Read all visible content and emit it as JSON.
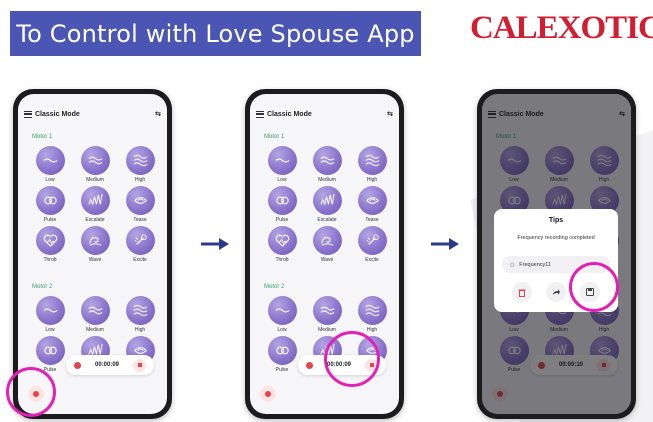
{
  "banner": {
    "title": "To Control with Love Spouse App"
  },
  "brand": {
    "name": "CALEXOTICS",
    "mark": "®"
  },
  "colors": {
    "banner": "#4b56b4",
    "brand": "#d21e33",
    "highlight": "#e41fb6",
    "motor_label": "#3aa06a",
    "record": "#e2454d"
  },
  "phones": [
    {
      "mode_title": "Classic Mode",
      "motor1_label": "Motor 1",
      "motor2_label": "Motor 2",
      "motor1_patterns": [
        "Low",
        "Medium",
        "High",
        "Pulse",
        "Escalate",
        "Tease",
        "Throb",
        "Wave",
        "Excite"
      ],
      "motor2_patterns": [
        "Low",
        "Medium",
        "High",
        "Pulse",
        "",
        "Tease"
      ],
      "timer": "00:00:09"
    },
    {
      "mode_title": "Classic Mode",
      "motor1_label": "Motor 1",
      "motor2_label": "Motor 2",
      "motor1_patterns": [
        "Low",
        "Medium",
        "High",
        "Pulse",
        "Escalate",
        "Tease",
        "Throb",
        "Wave",
        "Excite"
      ],
      "motor2_patterns": [
        "Low",
        "Medium",
        "High",
        "Pulse",
        "",
        "Tease"
      ],
      "timer": "00:00:09"
    },
    {
      "mode_title": "Classic Mode",
      "motor1_label": "Motor 1",
      "motor2_label": "Motor 2",
      "motor1_patterns": [
        "Low",
        "Medium",
        "High",
        "Pulse",
        "Escalate",
        "Tease",
        "Throb",
        "Wave",
        "Excite"
      ],
      "motor2_patterns": [
        "Low",
        "Medium",
        "High",
        "Pulse",
        "",
        "Tease"
      ],
      "timer": "00:00:10",
      "dialog": {
        "title": "Tips",
        "message": "Frequency recording completed",
        "item": "Frequency11"
      }
    }
  ],
  "icons": {
    "patterns": [
      "low-wave-icon",
      "medium-wave-icon",
      "high-wave-icon",
      "pulse-icon",
      "escalate-icon",
      "tease-icon",
      "throb-heart-icon",
      "wave-swirl-icon",
      "excite-icon"
    ],
    "menu": "menu-icon",
    "signal": "signal-icon",
    "delete": "trash-icon",
    "share": "share-icon",
    "save": "save-icon"
  }
}
